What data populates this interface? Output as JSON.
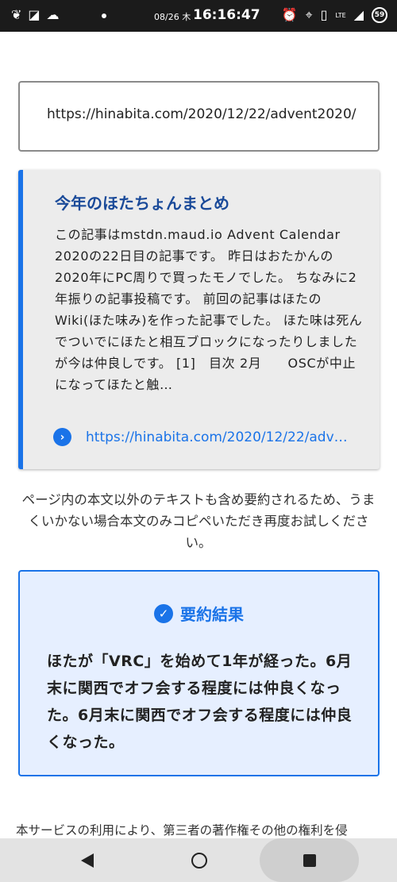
{
  "status_bar": {
    "date": "08/26 木",
    "time": "16:16:47",
    "network": "LTE",
    "battery": "59"
  },
  "url_input": {
    "value": "https://hinabita.com/2020/12/22/advent2020/"
  },
  "article_card": {
    "title": "今年のほたちょんまとめ",
    "excerpt": "この記事はmstdn.maud.io Advent Calendar 2020の22日目の記事です。 昨日はおたかんの2020年にPC周りで買ったモノでした。 ちなみに2年振りの記事投稿です。 前回の記事はほたのWiki(ほた味み)を作った記事でした。 ほた味は死んでついでにほたと相互ブロックになったりしましたが今は仲良しです。 [1]　目次 2月　　OSCが中止になってほたと触…",
    "link": "https://hinabita.com/2020/12/22/advent2020/"
  },
  "notice": "ページ内の本文以外のテキストも含め要約されるため、うまくいかない場合本文のみコピペいただき再度お試しください。",
  "result": {
    "title": "要約結果",
    "summary": "ほたが「VRC」を始めて1年が経った。6月末に関西でオフ会する程度には仲良くなった。6月末に関西でオフ会する程度には仲良くなった。"
  },
  "footer": "本サービスの利用により、第三者の著作権その他の権利を侵",
  "colors": {
    "accent": "#1a73e8",
    "card_bg": "#ececec",
    "result_bg": "#e6efff"
  }
}
